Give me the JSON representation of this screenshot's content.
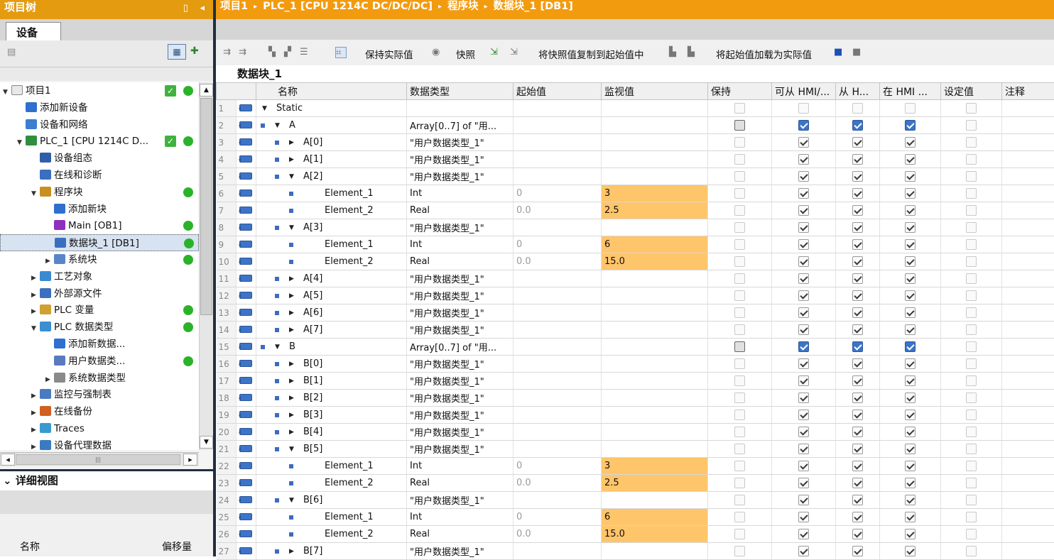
{
  "left_panel": {
    "header": "项目树",
    "tab": "设备",
    "tree": [
      {
        "label": "项目1",
        "level": 0,
        "arrow": "down",
        "status": "check-dot"
      },
      {
        "label": "添加新设备",
        "level": 1,
        "arrow": "",
        "status": ""
      },
      {
        "label": "设备和网络",
        "level": 1,
        "arrow": "",
        "status": ""
      },
      {
        "label": "PLC_1 [CPU 1214C D...",
        "level": 1,
        "arrow": "down",
        "status": "check-dot"
      },
      {
        "label": "设备组态",
        "level": 2,
        "arrow": "",
        "status": ""
      },
      {
        "label": "在线和诊断",
        "level": 2,
        "arrow": "",
        "status": ""
      },
      {
        "label": "程序块",
        "level": 2,
        "arrow": "down",
        "status": "dot"
      },
      {
        "label": "添加新块",
        "level": 3,
        "arrow": "",
        "status": ""
      },
      {
        "label": "Main [OB1]",
        "level": 3,
        "arrow": "",
        "status": "dot"
      },
      {
        "label": "数据块_1 [DB1]",
        "level": 3,
        "arrow": "",
        "status": "dot",
        "selected": true
      },
      {
        "label": "系统块",
        "level": 3,
        "arrow": "right",
        "status": "dot"
      },
      {
        "label": "工艺对象",
        "level": 2,
        "arrow": "right",
        "status": ""
      },
      {
        "label": "外部源文件",
        "level": 2,
        "arrow": "right",
        "status": ""
      },
      {
        "label": "PLC 变量",
        "level": 2,
        "arrow": "right",
        "status": "dot"
      },
      {
        "label": "PLC 数据类型",
        "level": 2,
        "arrow": "down",
        "status": "dot"
      },
      {
        "label": "添加新数据...",
        "level": 3,
        "arrow": "",
        "status": ""
      },
      {
        "label": "用户数据类...",
        "level": 3,
        "arrow": "",
        "status": "dot"
      },
      {
        "label": "系统数据类型",
        "level": 3,
        "arrow": "right",
        "status": ""
      },
      {
        "label": "监控与强制表",
        "level": 2,
        "arrow": "right",
        "status": ""
      },
      {
        "label": "在线备份",
        "level": 2,
        "arrow": "right",
        "status": ""
      },
      {
        "label": "Traces",
        "level": 2,
        "arrow": "right",
        "status": ""
      },
      {
        "label": "设备代理数据",
        "level": 2,
        "arrow": "right",
        "status": ""
      }
    ],
    "detail_header": "详细视图",
    "detail_col_name": "名称",
    "detail_col_offset": "偏移量"
  },
  "breadcrumb": [
    "项目1",
    "PLC_1 [CPU 1214C DC/DC/DC]",
    "程序块",
    "数据块_1 [DB1]"
  ],
  "toolbar": {
    "keep_actual": "保持实际值",
    "snapshot": "快照",
    "copy_snapshot": "将快照值复制到起始值中",
    "load_start": "将起始值加载为实际值"
  },
  "db_title": "数据块_1",
  "columns": [
    "名称",
    "数据类型",
    "起始值",
    "监视值",
    "保持",
    "可从 HMI/...",
    "从 H...",
    "在 HMI ...",
    "设定值",
    "注释"
  ],
  "rows": [
    {
      "n": "1",
      "name": "Static",
      "lvl": 0,
      "arrow": "down",
      "bullet": false,
      "type": "",
      "start": "",
      "mon": "",
      "hl": false,
      "retain": "dim",
      "hmi": "dim"
    },
    {
      "n": "2",
      "name": "A",
      "lvl": 1,
      "arrow": "down",
      "bullet": true,
      "type": "Array[0..7] of \"用...",
      "start": "",
      "mon": "",
      "hl": false,
      "retain": "half",
      "hmi": "blue"
    },
    {
      "n": "3",
      "name": "A[0]",
      "lvl": 2,
      "arrow": "right",
      "bullet": true,
      "type": "\"用户数据类型_1\"",
      "start": "",
      "mon": "",
      "hl": false,
      "retain": "dim",
      "hmi": "on"
    },
    {
      "n": "4",
      "name": "A[1]",
      "lvl": 2,
      "arrow": "right",
      "bullet": true,
      "type": "\"用户数据类型_1\"",
      "start": "",
      "mon": "",
      "hl": false,
      "retain": "dim",
      "hmi": "on"
    },
    {
      "n": "5",
      "name": "A[2]",
      "lvl": 2,
      "arrow": "down",
      "bullet": true,
      "type": "\"用户数据类型_1\"",
      "start": "",
      "mon": "",
      "hl": false,
      "retain": "dim",
      "hmi": "on"
    },
    {
      "n": "6",
      "name": "Element_1",
      "lvl": 3,
      "arrow": "",
      "bullet": true,
      "type": "Int",
      "start": "0",
      "mon": "3",
      "hl": true,
      "retain": "dim",
      "hmi": "on"
    },
    {
      "n": "7",
      "name": "Element_2",
      "lvl": 3,
      "arrow": "",
      "bullet": true,
      "type": "Real",
      "start": "0.0",
      "mon": "2.5",
      "hl": true,
      "retain": "dim",
      "hmi": "on"
    },
    {
      "n": "8",
      "name": "A[3]",
      "lvl": 2,
      "arrow": "down",
      "bullet": true,
      "type": "\"用户数据类型_1\"",
      "start": "",
      "mon": "",
      "hl": false,
      "retain": "dim",
      "hmi": "on"
    },
    {
      "n": "9",
      "name": "Element_1",
      "lvl": 3,
      "arrow": "",
      "bullet": true,
      "type": "Int",
      "start": "0",
      "mon": "6",
      "hl": true,
      "retain": "dim",
      "hmi": "on"
    },
    {
      "n": "10",
      "name": "Element_2",
      "lvl": 3,
      "arrow": "",
      "bullet": true,
      "type": "Real",
      "start": "0.0",
      "mon": "15.0",
      "hl": true,
      "retain": "dim",
      "hmi": "on"
    },
    {
      "n": "11",
      "name": "A[4]",
      "lvl": 2,
      "arrow": "right",
      "bullet": true,
      "type": "\"用户数据类型_1\"",
      "start": "",
      "mon": "",
      "hl": false,
      "retain": "dim",
      "hmi": "on"
    },
    {
      "n": "12",
      "name": "A[5]",
      "lvl": 2,
      "arrow": "right",
      "bullet": true,
      "type": "\"用户数据类型_1\"",
      "start": "",
      "mon": "",
      "hl": false,
      "retain": "dim",
      "hmi": "on"
    },
    {
      "n": "13",
      "name": "A[6]",
      "lvl": 2,
      "arrow": "right",
      "bullet": true,
      "type": "\"用户数据类型_1\"",
      "start": "",
      "mon": "",
      "hl": false,
      "retain": "dim",
      "hmi": "on"
    },
    {
      "n": "14",
      "name": "A[7]",
      "lvl": 2,
      "arrow": "right",
      "bullet": true,
      "type": "\"用户数据类型_1\"",
      "start": "",
      "mon": "",
      "hl": false,
      "retain": "dim",
      "hmi": "on"
    },
    {
      "n": "15",
      "name": "B",
      "lvl": 1,
      "arrow": "down",
      "bullet": true,
      "type": "Array[0..7] of \"用...",
      "start": "",
      "mon": "",
      "hl": false,
      "retain": "half",
      "hmi": "blue"
    },
    {
      "n": "16",
      "name": "B[0]",
      "lvl": 2,
      "arrow": "right",
      "bullet": true,
      "type": "\"用户数据类型_1\"",
      "start": "",
      "mon": "",
      "hl": false,
      "retain": "dim",
      "hmi": "on"
    },
    {
      "n": "17",
      "name": "B[1]",
      "lvl": 2,
      "arrow": "right",
      "bullet": true,
      "type": "\"用户数据类型_1\"",
      "start": "",
      "mon": "",
      "hl": false,
      "retain": "dim",
      "hmi": "on"
    },
    {
      "n": "18",
      "name": "B[2]",
      "lvl": 2,
      "arrow": "right",
      "bullet": true,
      "type": "\"用户数据类型_1\"",
      "start": "",
      "mon": "",
      "hl": false,
      "retain": "dim",
      "hmi": "on"
    },
    {
      "n": "19",
      "name": "B[3]",
      "lvl": 2,
      "arrow": "right",
      "bullet": true,
      "type": "\"用户数据类型_1\"",
      "start": "",
      "mon": "",
      "hl": false,
      "retain": "dim",
      "hmi": "on"
    },
    {
      "n": "20",
      "name": "B[4]",
      "lvl": 2,
      "arrow": "right",
      "bullet": true,
      "type": "\"用户数据类型_1\"",
      "start": "",
      "mon": "",
      "hl": false,
      "retain": "dim",
      "hmi": "on"
    },
    {
      "n": "21",
      "name": "B[5]",
      "lvl": 2,
      "arrow": "down",
      "bullet": true,
      "type": "\"用户数据类型_1\"",
      "start": "",
      "mon": "",
      "hl": false,
      "retain": "dim",
      "hmi": "on"
    },
    {
      "n": "22",
      "name": "Element_1",
      "lvl": 3,
      "arrow": "",
      "bullet": true,
      "type": "Int",
      "start": "0",
      "mon": "3",
      "hl": true,
      "retain": "dim",
      "hmi": "on"
    },
    {
      "n": "23",
      "name": "Element_2",
      "lvl": 3,
      "arrow": "",
      "bullet": true,
      "type": "Real",
      "start": "0.0",
      "mon": "2.5",
      "hl": true,
      "retain": "dim",
      "hmi": "on"
    },
    {
      "n": "24",
      "name": "B[6]",
      "lvl": 2,
      "arrow": "down",
      "bullet": true,
      "type": "\"用户数据类型_1\"",
      "start": "",
      "mon": "",
      "hl": false,
      "retain": "dim",
      "hmi": "on"
    },
    {
      "n": "25",
      "name": "Element_1",
      "lvl": 3,
      "arrow": "",
      "bullet": true,
      "type": "Int",
      "start": "0",
      "mon": "6",
      "hl": true,
      "retain": "dim",
      "hmi": "on"
    },
    {
      "n": "26",
      "name": "Element_2",
      "lvl": 3,
      "arrow": "",
      "bullet": true,
      "type": "Real",
      "start": "0.0",
      "mon": "15.0",
      "hl": true,
      "retain": "dim",
      "hmi": "on"
    },
    {
      "n": "27",
      "name": "B[7]",
      "lvl": 2,
      "arrow": "right",
      "bullet": true,
      "type": "\"用户数据类型_1\"",
      "start": "",
      "mon": "",
      "hl": false,
      "retain": "dim",
      "hmi": "on"
    }
  ],
  "colors": {
    "accent": "#f29b0f",
    "highlight": "#ffc56a",
    "status_green": "#2ab32a"
  }
}
